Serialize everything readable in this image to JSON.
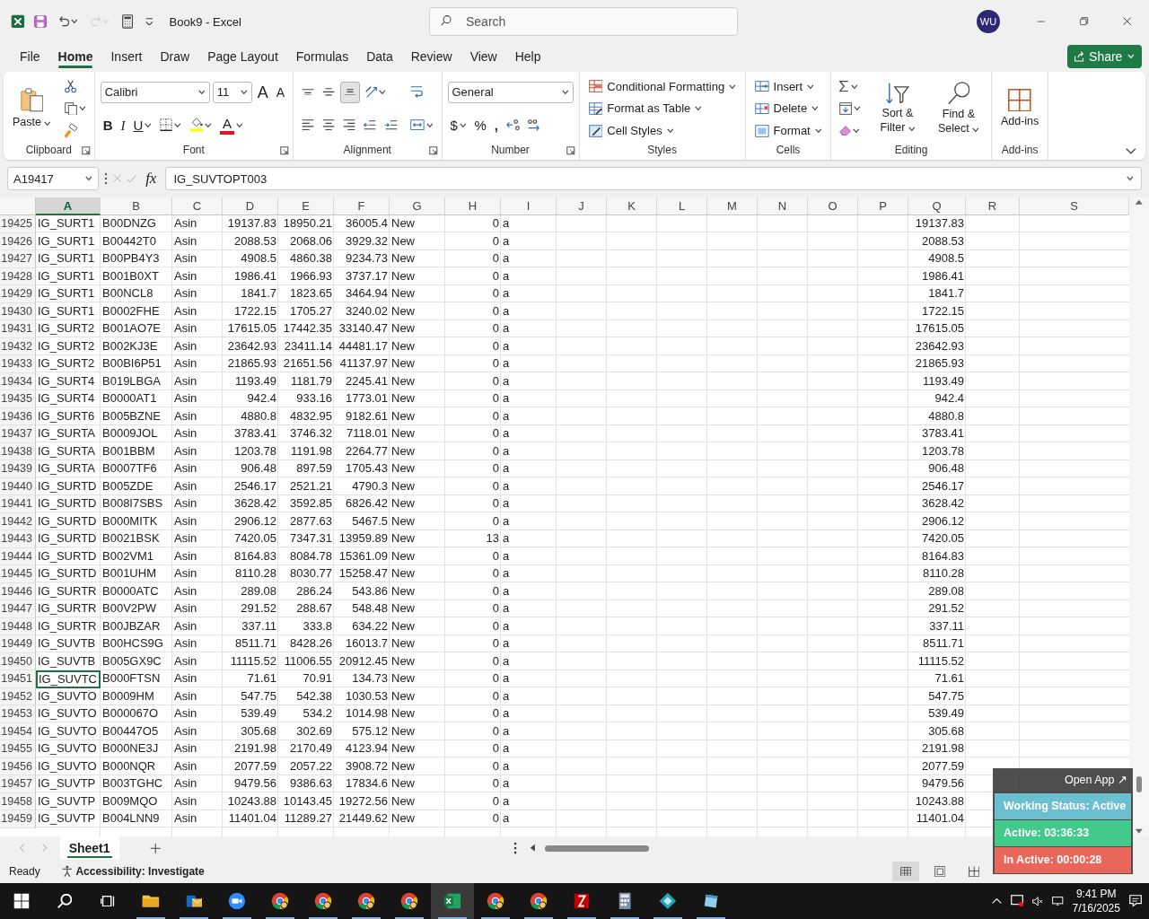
{
  "window": {
    "title": "Book9  -  Excel"
  },
  "quick_access": [
    {
      "kind": "save",
      "disabled": false
    },
    {
      "kind": "undo",
      "disabled": false,
      "caret": true
    },
    {
      "kind": "redo",
      "disabled": true,
      "caret": true
    },
    {
      "kind": "calculator",
      "disabled": false
    },
    {
      "kind": "customize",
      "disabled": false
    }
  ],
  "search": {
    "placeholder": "Search"
  },
  "account": {
    "initials": "WU"
  },
  "menu_tabs": [
    {
      "label": "File",
      "selected": false
    },
    {
      "label": "Home",
      "selected": true
    },
    {
      "label": "Insert",
      "selected": false
    },
    {
      "label": "Draw",
      "selected": false
    },
    {
      "label": "Page Layout",
      "selected": false
    },
    {
      "label": "Formulas",
      "selected": false
    },
    {
      "label": "Data",
      "selected": false
    },
    {
      "label": "Review",
      "selected": false
    },
    {
      "label": "View",
      "selected": false
    },
    {
      "label": "Help",
      "selected": false
    }
  ],
  "share_button": {
    "label": "Share"
  },
  "ribbon": {
    "groups": [
      {
        "label": "Clipboard",
        "launcher": true,
        "columns": [
          [
            [
              {
                "kind": "large",
                "label": "Paste",
                "caret": true
              }
            ]
          ],
          [
            [
              {
                "kind": "icon"
              }
            ],
            [
              {
                "kind": "icon",
                "caret": true
              }
            ],
            [
              {
                "kind": "icon"
              }
            ]
          ]
        ]
      },
      {
        "label": "Font",
        "launcher": true,
        "columns": [
          [
            [
              {
                "kind": "select",
                "value": "Calibri"
              },
              {
                "kind": "select",
                "value": "11"
              },
              {
                "kind": "text",
                "label": "A"
              },
              {
                "kind": "text",
                "label": "A"
              }
            ],
            [
              {
                "kind": "text",
                "label": "B"
              },
              {
                "kind": "text",
                "label": "I"
              },
              {
                "kind": "text",
                "label": "U",
                "caret": true
              },
              {
                "kind": "icon",
                "caret": true
              },
              {
                "kind": "icon",
                "color": "#ffff00",
                "caret": true
              },
              {
                "kind": "text",
                "label": "A",
                "color": "#e81123",
                "caret": true
              }
            ]
          ]
        ]
      },
      {
        "label": "Alignment",
        "launcher": true,
        "columns": [
          [
            [
              {
                "kind": "icon",
                "selected": false
              },
              {
                "kind": "icon",
                "selected": false
              },
              {
                "kind": "icon",
                "selected": true
              },
              {
                "kind": "icon",
                "caret": true
              }
            ],
            [
              {
                "kind": "icon"
              },
              {
                "kind": "icon"
              },
              {
                "kind": "icon"
              },
              {
                "kind": "icon"
              },
              {
                "kind": "icon"
              }
            ]
          ],
          [
            [
              {
                "kind": "icon"
              }
            ],
            [
              {
                "kind": "icon",
                "caret": true
              }
            ]
          ]
        ]
      },
      {
        "label": "Number",
        "launcher": true,
        "columns": [
          [
            [
              {
                "kind": "select",
                "value": "General"
              }
            ],
            [
              {
                "kind": "text",
                "label": "$",
                "caret": true
              },
              {
                "kind": "text",
                "label": "%"
              },
              {
                "kind": "text",
                "label": ","
              },
              {
                "kind": "icon"
              },
              {
                "kind": "icon"
              }
            ]
          ]
        ]
      },
      {
        "label": "Styles",
        "launcher": false,
        "columns": [
          [
            [
              {
                "kind": "row",
                "label": "Conditional Formatting",
                "caret": true
              }
            ],
            [
              {
                "kind": "row",
                "label": "Format as Table",
                "caret": true
              }
            ],
            [
              {
                "kind": "row",
                "label": "Cell Styles",
                "caret": true
              }
            ]
          ]
        ]
      },
      {
        "label": "Cells",
        "launcher": false,
        "columns": [
          [
            [
              {
                "kind": "row",
                "label": "Insert",
                "caret": true
              }
            ],
            [
              {
                "kind": "row",
                "label": "Delete",
                "caret": true
              }
            ],
            [
              {
                "kind": "row",
                "label": "Format",
                "caret": true
              }
            ]
          ]
        ]
      },
      {
        "label": "Editing",
        "launcher": false,
        "columns": [
          [
            [
              {
                "kind": "icon",
                "caret": true
              }
            ],
            [
              {
                "kind": "icon",
                "caret": true
              }
            ],
            [
              {
                "kind": "icon",
                "caret": true
              }
            ]
          ],
          [
            [
              {
                "kind": "large",
                "label": "Sort & Filter",
                "caret": true
              }
            ]
          ],
          [
            [
              {
                "kind": "large",
                "label": "Find & Select",
                "caret": true
              }
            ]
          ]
        ]
      },
      {
        "label": "Add-ins",
        "launcher": false,
        "columns": [
          [
            [
              {
                "kind": "large",
                "label": "Add-ins"
              }
            ]
          ]
        ]
      }
    ]
  },
  "formula_bar": {
    "name_box": "A19417",
    "function_label": "fx",
    "formula": "IG_SUVTOPT003"
  },
  "grid": {
    "columns": [
      {
        "letter": "A",
        "selected": true
      },
      {
        "letter": "B",
        "selected": false
      },
      {
        "letter": "C",
        "selected": false
      },
      {
        "letter": "D",
        "selected": false
      },
      {
        "letter": "E",
        "selected": false
      },
      {
        "letter": "F",
        "selected": false
      },
      {
        "letter": "G",
        "selected": false
      },
      {
        "letter": "H",
        "selected": false
      },
      {
        "letter": "I",
        "selected": false
      },
      {
        "letter": "J",
        "selected": false
      },
      {
        "letter": "K",
        "selected": false
      },
      {
        "letter": "L",
        "selected": false
      },
      {
        "letter": "M",
        "selected": false
      },
      {
        "letter": "N",
        "selected": false
      },
      {
        "letter": "O",
        "selected": false
      },
      {
        "letter": "P",
        "selected": false
      },
      {
        "letter": "Q",
        "selected": false
      },
      {
        "letter": "R",
        "selected": false
      },
      {
        "letter": "S",
        "selected": false
      }
    ],
    "rows": [
      {
        "number": "19425",
        "selected": false,
        "A": "IG_SURT1",
        "B": "B00DNZG",
        "C": "Asin",
        "D": "19137.83",
        "E": "18950.21",
        "F": "36005.4",
        "G": "New",
        "H": "0",
        "I": "a",
        "Q": "19137.83"
      },
      {
        "number": "19426",
        "selected": false,
        "A": "IG_SURT1",
        "B": "B00442T0",
        "C": "Asin",
        "D": "2088.53",
        "E": "2068.06",
        "F": "3929.32",
        "G": "New",
        "H": "0",
        "I": "a",
        "Q": "2088.53"
      },
      {
        "number": "19427",
        "selected": false,
        "A": "IG_SURT1",
        "B": "B00PB4Y3",
        "C": "Asin",
        "D": "4908.5",
        "E": "4860.38",
        "F": "9234.73",
        "G": "New",
        "H": "0",
        "I": "a",
        "Q": "4908.5"
      },
      {
        "number": "19428",
        "selected": false,
        "A": "IG_SURT1",
        "B": "B001B0XT",
        "C": "Asin",
        "D": "1986.41",
        "E": "1966.93",
        "F": "3737.17",
        "G": "New",
        "H": "0",
        "I": "a",
        "Q": "1986.41"
      },
      {
        "number": "19429",
        "selected": false,
        "A": "IG_SURT1",
        "B": "B00NCL8",
        "C": "Asin",
        "D": "1841.7",
        "E": "1823.65",
        "F": "3464.94",
        "G": "New",
        "H": "0",
        "I": "a",
        "Q": "1841.7"
      },
      {
        "number": "19430",
        "selected": false,
        "A": "IG_SURT1",
        "B": "B0002FHE",
        "C": "Asin",
        "D": "1722.15",
        "E": "1705.27",
        "F": "3240.02",
        "G": "New",
        "H": "0",
        "I": "a",
        "Q": "1722.15"
      },
      {
        "number": "19431",
        "selected": false,
        "A": "IG_SURT2",
        "B": "B001AO7E",
        "C": "Asin",
        "D": "17615.05",
        "E": "17442.35",
        "F": "33140.47",
        "G": "New",
        "H": "0",
        "I": "a",
        "Q": "17615.05"
      },
      {
        "number": "19432",
        "selected": false,
        "A": "IG_SURT2",
        "B": "B002KJ3E",
        "C": "Asin",
        "D": "23642.93",
        "E": "23411.14",
        "F": "44481.17",
        "G": "New",
        "H": "0",
        "I": "a",
        "Q": "23642.93"
      },
      {
        "number": "19433",
        "selected": false,
        "A": "IG_SURT2",
        "B": "B00BI6P51",
        "C": "Asin",
        "D": "21865.93",
        "E": "21651.56",
        "F": "41137.97",
        "G": "New",
        "H": "0",
        "I": "a",
        "Q": "21865.93"
      },
      {
        "number": "19434",
        "selected": false,
        "A": "IG_SURT4",
        "B": "B019LBGA",
        "C": "Asin",
        "D": "1193.49",
        "E": "1181.79",
        "F": "2245.41",
        "G": "New",
        "H": "0",
        "I": "a",
        "Q": "1193.49"
      },
      {
        "number": "19435",
        "selected": false,
        "A": "IG_SURT4",
        "B": "B0000AT1",
        "C": "Asin",
        "D": "942.4",
        "E": "933.16",
        "F": "1773.01",
        "G": "New",
        "H": "0",
        "I": "a",
        "Q": "942.4"
      },
      {
        "number": "19436",
        "selected": false,
        "A": "IG_SURT6",
        "B": "B005BZNE",
        "C": "Asin",
        "D": "4880.8",
        "E": "4832.95",
        "F": "9182.61",
        "G": "New",
        "H": "0",
        "I": "a",
        "Q": "4880.8"
      },
      {
        "number": "19437",
        "selected": false,
        "A": "IG_SURTA",
        "B": "B0009JOL",
        "C": "Asin",
        "D": "3783.41",
        "E": "3746.32",
        "F": "7118.01",
        "G": "New",
        "H": "0",
        "I": "a",
        "Q": "3783.41"
      },
      {
        "number": "19438",
        "selected": false,
        "A": "IG_SURTA",
        "B": "B001BBM",
        "C": "Asin",
        "D": "1203.78",
        "E": "1191.98",
        "F": "2264.77",
        "G": "New",
        "H": "0",
        "I": "a",
        "Q": "1203.78"
      },
      {
        "number": "19439",
        "selected": false,
        "A": "IG_SURTA",
        "B": "B0007TF6",
        "C": "Asin",
        "D": "906.48",
        "E": "897.59",
        "F": "1705.43",
        "G": "New",
        "H": "0",
        "I": "a",
        "Q": "906.48"
      },
      {
        "number": "19440",
        "selected": false,
        "A": "IG_SURTD",
        "B": "B005ZDE",
        "C": "Asin",
        "D": "2546.17",
        "E": "2521.21",
        "F": "4790.3",
        "G": "New",
        "H": "0",
        "I": "a",
        "Q": "2546.17"
      },
      {
        "number": "19441",
        "selected": false,
        "A": "IG_SURTD",
        "B": "B008I7SBS",
        "C": "Asin",
        "D": "3628.42",
        "E": "3592.85",
        "F": "6826.42",
        "G": "New",
        "H": "0",
        "I": "a",
        "Q": "3628.42"
      },
      {
        "number": "19442",
        "selected": false,
        "A": "IG_SURTD",
        "B": "B000MITK",
        "C": "Asin",
        "D": "2906.12",
        "E": "2877.63",
        "F": "5467.5",
        "G": "New",
        "H": "0",
        "I": "a",
        "Q": "2906.12"
      },
      {
        "number": "19443",
        "selected": false,
        "A": "IG_SURTD",
        "B": "B0021BSK",
        "C": "Asin",
        "D": "7420.05",
        "E": "7347.31",
        "F": "13959.89",
        "G": "New",
        "H": "13",
        "I": "a",
        "Q": "7420.05"
      },
      {
        "number": "19444",
        "selected": false,
        "A": "IG_SURTD",
        "B": "B002VM1",
        "C": "Asin",
        "D": "8164.83",
        "E": "8084.78",
        "F": "15361.09",
        "G": "New",
        "H": "0",
        "I": "a",
        "Q": "8164.83"
      },
      {
        "number": "19445",
        "selected": false,
        "A": "IG_SURTD",
        "B": "B001UHM",
        "C": "Asin",
        "D": "8110.28",
        "E": "8030.77",
        "F": "15258.47",
        "G": "New",
        "H": "0",
        "I": "a",
        "Q": "8110.28"
      },
      {
        "number": "19446",
        "selected": false,
        "A": "IG_SURTR",
        "B": "B0000ATC",
        "C": "Asin",
        "D": "289.08",
        "E": "286.24",
        "F": "543.86",
        "G": "New",
        "H": "0",
        "I": "a",
        "Q": "289.08"
      },
      {
        "number": "19447",
        "selected": false,
        "A": "IG_SURTR",
        "B": "B00V2PW",
        "C": "Asin",
        "D": "291.52",
        "E": "288.67",
        "F": "548.48",
        "G": "New",
        "H": "0",
        "I": "a",
        "Q": "291.52"
      },
      {
        "number": "19448",
        "selected": false,
        "A": "IG_SURTR",
        "B": "B00JBZAR",
        "C": "Asin",
        "D": "337.11",
        "E": "333.8",
        "F": "634.22",
        "G": "New",
        "H": "0",
        "I": "a",
        "Q": "337.11"
      },
      {
        "number": "19449",
        "selected": false,
        "A": "IG_SUVTB",
        "B": "B00HCS9G",
        "C": "Asin",
        "D": "8511.71",
        "E": "8428.26",
        "F": "16013.7",
        "G": "New",
        "H": "0",
        "I": "a",
        "Q": "8511.71"
      },
      {
        "number": "19450",
        "selected": false,
        "A": "IG_SUVTB",
        "B": "B005GX9C",
        "C": "Asin",
        "D": "11115.52",
        "E": "11006.55",
        "F": "20912.45",
        "G": "New",
        "H": "0",
        "I": "a",
        "Q": "11115.52"
      },
      {
        "number": "19451",
        "selected": true,
        "A": "IG_SUVTC",
        "B": "B000FTSN",
        "C": "Asin",
        "D": "71.61",
        "E": "70.91",
        "F": "134.73",
        "G": "New",
        "H": "0",
        "I": "a",
        "Q": "71.61"
      },
      {
        "number": "19452",
        "selected": false,
        "A": "IG_SUVTO",
        "B": "B0009HM",
        "C": "Asin",
        "D": "547.75",
        "E": "542.38",
        "F": "1030.53",
        "G": "New",
        "H": "0",
        "I": "a",
        "Q": "547.75"
      },
      {
        "number": "19453",
        "selected": false,
        "A": "IG_SUVTO",
        "B": "B000067O",
        "C": "Asin",
        "D": "539.49",
        "E": "534.2",
        "F": "1014.98",
        "G": "New",
        "H": "0",
        "I": "a",
        "Q": "539.49"
      },
      {
        "number": "19454",
        "selected": false,
        "A": "IG_SUVTO",
        "B": "B00447O5",
        "C": "Asin",
        "D": "305.68",
        "E": "302.69",
        "F": "575.12",
        "G": "New",
        "H": "0",
        "I": "a",
        "Q": "305.68"
      },
      {
        "number": "19455",
        "selected": false,
        "A": "IG_SUVTO",
        "B": "B000NE3J",
        "C": "Asin",
        "D": "2191.98",
        "E": "2170.49",
        "F": "4123.94",
        "G": "New",
        "H": "0",
        "I": "a",
        "Q": "2191.98"
      },
      {
        "number": "19456",
        "selected": false,
        "A": "IG_SUVTO",
        "B": "B000NQR",
        "C": "Asin",
        "D": "2077.59",
        "E": "2057.22",
        "F": "3908.72",
        "G": "New",
        "H": "0",
        "I": "a",
        "Q": "2077.59"
      },
      {
        "number": "19457",
        "selected": false,
        "A": "IG_SUVTP",
        "B": "B003TGHC",
        "C": "Asin",
        "D": "9479.56",
        "E": "9386.63",
        "F": "17834.6",
        "G": "New",
        "H": "0",
        "I": "a",
        "Q": "9479.56"
      },
      {
        "number": "19458",
        "selected": false,
        "A": "IG_SUVTP",
        "B": "B009MQO",
        "C": "Asin",
        "D": "10243.88",
        "E": "10143.45",
        "F": "19272.56",
        "G": "New",
        "H": "0",
        "I": "a",
        "Q": "10243.88"
      },
      {
        "number": "19459",
        "selected": false,
        "A": "IG_SUVTP",
        "B": "B004LNN9",
        "C": "Asin",
        "D": "11401.04",
        "E": "11289.27",
        "F": "21449.62",
        "G": "New",
        "H": "0",
        "I": "a",
        "Q": "11401.04"
      }
    ]
  },
  "sheet_tabs": [
    {
      "label": "Sheet1",
      "selected": true
    }
  ],
  "status_bar": {
    "mode": "Ready",
    "accessibility": "Accessibility: Investigate",
    "views": [
      {
        "kind": "normal",
        "selected": true
      },
      {
        "kind": "page-layout",
        "selected": false
      },
      {
        "kind": "page-break",
        "selected": false
      }
    ]
  },
  "tracker": {
    "link": "Open App ↗",
    "lines": [
      {
        "text": "Working Status: Active",
        "color": "#6cbfd0"
      },
      {
        "text": "Active: 03:36:33",
        "color": "#43c98a"
      },
      {
        "text": "In Active: 00:00:28",
        "color": "#e8675a"
      }
    ]
  },
  "taskbar": {
    "apps": [
      {
        "kind": "explorer",
        "running": true,
        "selected": false
      },
      {
        "kind": "mail",
        "running": true,
        "selected": false
      },
      {
        "kind": "video",
        "running": true,
        "selected": false
      },
      {
        "kind": "browser",
        "running": true,
        "selected": false
      },
      {
        "kind": "browser",
        "running": true,
        "selected": false
      },
      {
        "kind": "browser",
        "running": true,
        "selected": false
      },
      {
        "kind": "browser",
        "running": true,
        "selected": false
      },
      {
        "kind": "spreadsheet",
        "running": true,
        "selected": true
      },
      {
        "kind": "browser",
        "running": true,
        "selected": false
      },
      {
        "kind": "browser",
        "running": true,
        "selected": false
      },
      {
        "kind": "ftp",
        "running": true,
        "selected": false
      },
      {
        "kind": "calculator",
        "running": true,
        "selected": false
      },
      {
        "kind": "diamond",
        "running": true,
        "selected": false
      },
      {
        "kind": "notes",
        "running": true,
        "selected": false
      }
    ],
    "time": "9:41 PM",
    "date": "7/16/2025"
  }
}
